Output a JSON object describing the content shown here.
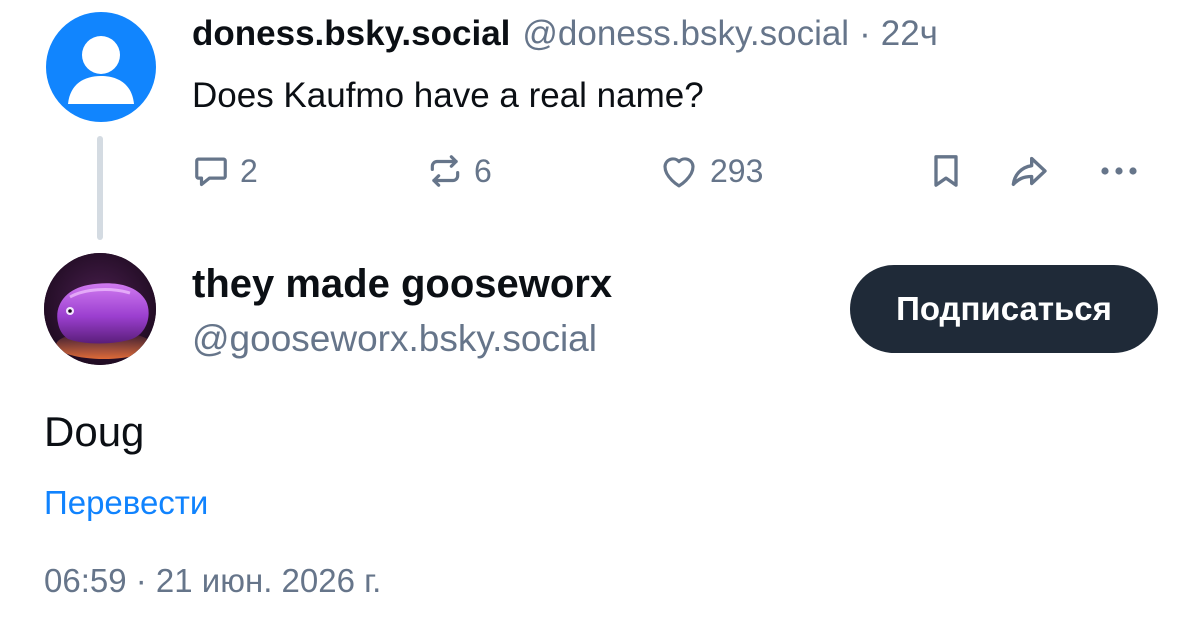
{
  "parent_post": {
    "display_name": "doness.bsky.social",
    "handle": "@doness.bsky.social",
    "separator": "·",
    "time_ago": "22ч",
    "text": "Does Kaufmo have a real name?",
    "actions": {
      "reply_icon": "comment-icon",
      "reply_count": "2",
      "repost_icon": "repost-icon",
      "repost_count": "6",
      "like_icon": "heart-icon",
      "like_count": "293",
      "bookmark_icon": "bookmark-icon",
      "share_icon": "share-icon",
      "more_icon": "more-icon"
    }
  },
  "main_post": {
    "display_name": "they made gooseworx",
    "handle": "@gooseworx.bsky.social",
    "follow_label": "Подписаться",
    "text": "Doug",
    "translate_label": "Перевести",
    "timestamp": "06:59 · 21 июн. 2026 г."
  },
  "colors": {
    "text_primary": "#0b0f14",
    "text_secondary": "#66758a",
    "link": "#1083fe",
    "default_avatar": "#1185fe",
    "follow_button_bg": "#1f2a38",
    "thread_line": "#d4dbe2"
  }
}
